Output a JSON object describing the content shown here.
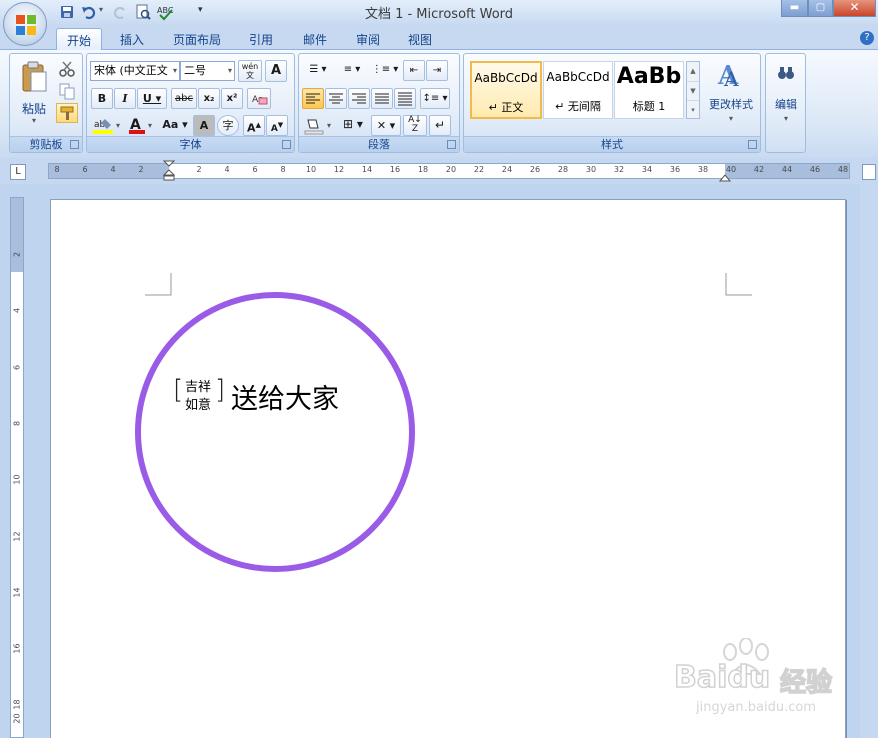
{
  "window": {
    "title": "文档 1 - Microsoft Word"
  },
  "tabs": [
    "开始",
    "插入",
    "页面布局",
    "引用",
    "邮件",
    "审阅",
    "视图"
  ],
  "clipboard": {
    "paste_label": "粘贴",
    "group_label": "剪贴板"
  },
  "font": {
    "name": "宋体 (中文正文",
    "size": "二号",
    "group_label": "字体",
    "phonetic_label": "wén\n文",
    "char_border_label": "A"
  },
  "paragraph": {
    "group_label": "段落"
  },
  "styles": {
    "group_label": "样式",
    "items": [
      {
        "preview": "AaBbCcDd",
        "name": "↵ 正文"
      },
      {
        "preview": "AaBbCcDd",
        "name": "↵ 无间隔"
      },
      {
        "preview": "AaBb",
        "name": "标题 1"
      }
    ],
    "change_label": "更改样式"
  },
  "editing": {
    "label": "编辑"
  },
  "ruler": {
    "h_labels": [
      "8",
      "6",
      "4",
      "2",
      "2",
      "4",
      "6",
      "8",
      "10",
      "12",
      "14",
      "16",
      "18",
      "20",
      "22",
      "24",
      "26",
      "28",
      "30",
      "32",
      "34",
      "36",
      "38",
      "40",
      "42",
      "44",
      "46",
      "48"
    ],
    "v_labels": [
      "2",
      "4",
      "6",
      "8",
      "10",
      "12",
      "14",
      "16",
      "18",
      "20"
    ]
  },
  "document": {
    "phonetic_top": "吉祥",
    "phonetic_bottom": "如意",
    "text": "送给大家",
    "circle_color": "#9a5ce6"
  },
  "watermark": {
    "brand": "Baidu",
    "brand2": "经验",
    "url": "jingyan.baidu.com"
  }
}
